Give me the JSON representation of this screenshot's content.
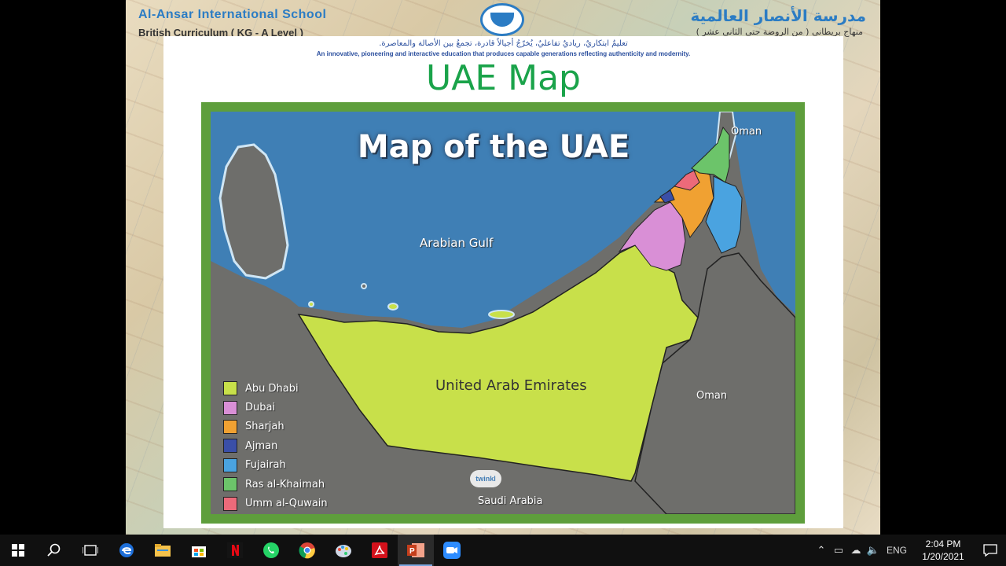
{
  "slide": {
    "school_name_en": "Al-Ansar International School",
    "curriculum_en": "British Curriculum ( KG - A Level )",
    "school_name_ar": "مدرسة الأنصار العالمية",
    "curriculum_ar": "منهاج بريطاني ( من الروضة حتى الثاني عشر )",
    "tagline_ar": "تعليمٌ ابتكاريٌ، رياديٌ تفاعليٌ، يُخرّجُ أجيالاً قادرة، تجمعُ بين الأصالة والمعاصرة.",
    "tagline_en": "An innovative, pioneering and interactive education that produces capable generations reflecting authenticity and modernity.",
    "title": "UAE Map"
  },
  "map": {
    "heading": "Map of the UAE",
    "labels": {
      "gulf": "Arabian Gulf",
      "uae": "United Arab Emirates",
      "oman_north": "Oman",
      "oman_east": "Oman",
      "saudi": "Saudi Arabia"
    },
    "watermark": "twinkl",
    "legend": [
      {
        "label": "Abu Dhabi",
        "color": "#c8e04a"
      },
      {
        "label": "Dubai",
        "color": "#d98fd6"
      },
      {
        "label": "Sharjah",
        "color": "#f0a132"
      },
      {
        "label": "Ajman",
        "color": "#3a4fa8"
      },
      {
        "label": "Fujairah",
        "color": "#4aa3e0"
      },
      {
        "label": "Ras al-Khaimah",
        "color": "#6cc46a"
      },
      {
        "label": "Umm al-Quwain",
        "color": "#ec6a7a"
      }
    ]
  },
  "taskbar": {
    "apps": [
      "start-icon",
      "search-icon",
      "task-view-icon",
      "edge-icon",
      "file-explorer-icon",
      "store-icon",
      "netflix-icon",
      "whatsapp-icon",
      "chrome-icon",
      "paint-icon",
      "acrobat-icon",
      "powerpoint-icon",
      "zoom-icon"
    ],
    "language": "ENG",
    "time": "2:04 PM",
    "date": "1/20/2021"
  }
}
